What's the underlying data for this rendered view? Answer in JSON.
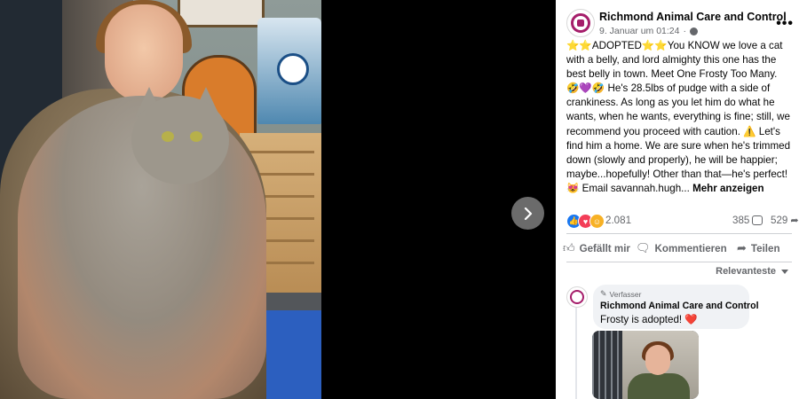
{
  "viewer": {
    "next_label": "Next photo"
  },
  "post": {
    "page_name": "Richmond Animal Care and Control",
    "timestamp": "9. Januar um 01:24",
    "more_options": "•••",
    "text_lines": [
      "⭐⭐ADOPTED⭐⭐You KNOW we love a cat",
      "with a belly, and lord almighty this one has the",
      "best belly in town. Meet One Frosty Too Many.",
      "🤣💜🤣 He's 28.5lbs of pudge with a side of",
      "crankiness. As long as you let him do what he",
      "wants, when he wants, everything is fine; still, we",
      "recommend you proceed with caution. ⚠️ Let's",
      "find him a home. We are sure when he's trimmed",
      "down (slowly and properly), he will be happier;",
      "maybe...hopefully! Other than that—he's perfect!",
      "😻 Email savannah.hugh..."
    ],
    "see_more": "Mehr anzeigen"
  },
  "reactions": {
    "count": "2.081",
    "comments": "385",
    "shares": "529"
  },
  "actions": {
    "like": "Gefällt mir",
    "comment": "Kommentieren",
    "share": "Teilen"
  },
  "comments_sort": "Relevanteste",
  "comment": {
    "badge": "Verfasser",
    "author": "Richmond Animal Care and Control",
    "text": "Frosty is adopted! ❤️"
  },
  "icons": {
    "next": "chevron-right-icon",
    "globe": "globe-icon",
    "like": "thumbs-up-icon",
    "comment": "comment-bubble-icon",
    "share": "share-arrow-icon",
    "pen": "pen-icon"
  },
  "colors": {
    "accent": "#a51d6a",
    "like_blue": "#1877f2",
    "love_red": "#f33e58",
    "care_yellow": "#f7b125",
    "secondary_text": "#65676b",
    "bubble_bg": "#f0f2f5"
  }
}
